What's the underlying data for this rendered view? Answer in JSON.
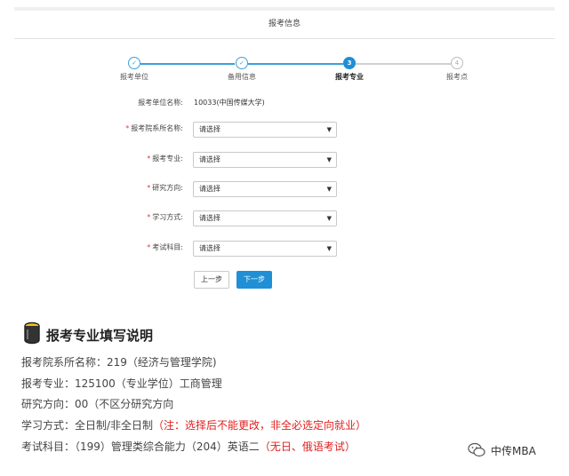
{
  "header": {
    "title": "报考信息"
  },
  "stepper": {
    "steps": [
      {
        "label": "报考单位",
        "symbol": "✓",
        "state": "done"
      },
      {
        "label": "备用信息",
        "symbol": "✓",
        "state": "done"
      },
      {
        "label": "报考专业",
        "symbol": "3",
        "state": "active"
      },
      {
        "label": "报考点",
        "symbol": "4",
        "state": "pending"
      }
    ],
    "colors": {
      "done": "#3aa0dc",
      "active": "#1f8fd6",
      "pending": "#d0d0d0"
    }
  },
  "form": {
    "unit": {
      "label": "报考单位名称:",
      "value": "10033(中国传媒大学)"
    },
    "fields": [
      {
        "label": "报考院系所名称:",
        "required": "*",
        "value": "请选择"
      },
      {
        "label": "报考专业:",
        "required": "*",
        "value": "请选择"
      },
      {
        "label": "研究方向:",
        "required": "*",
        "value": "请选择"
      },
      {
        "label": "学习方式:",
        "required": "*",
        "value": "请选择"
      },
      {
        "label": "考试科目:",
        "required": "*",
        "value": "请选择"
      }
    ],
    "prev_label": "上一步",
    "next_label": "下一步"
  },
  "notes": {
    "title": "报考专业填写说明",
    "lines": [
      {
        "text": "报考院系所名称：219（经济与管理学院)",
        "red": ""
      },
      {
        "text": "报考专业：125100（专业学位）工商管理",
        "red": ""
      },
      {
        "text": "研究方向：00（不区分研究方向",
        "red": ""
      },
      {
        "text": "学习方式：全日制/非全日制",
        "red": "（注：选择后不能更改，非全必选定向就业）"
      },
      {
        "text": "考试科目：（199）管理类综合能力（204）英语二",
        "red": "（无日、俄语考试）"
      }
    ]
  },
  "watermark": {
    "text": "中传MBA"
  }
}
